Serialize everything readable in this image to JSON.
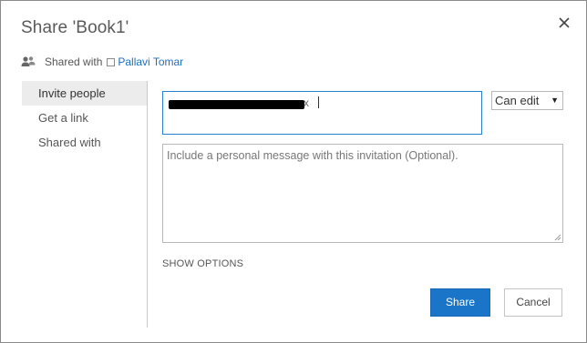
{
  "dialog": {
    "title": "Share 'Book1'"
  },
  "shared_with": {
    "label": "Shared with",
    "user": "Pallavi Tomar"
  },
  "nav": {
    "items": [
      {
        "label": "Invite people"
      },
      {
        "label": "Get a link"
      },
      {
        "label": "Shared with"
      }
    ]
  },
  "invite": {
    "chip_remove": "x"
  },
  "permission": {
    "selected": "Can edit"
  },
  "message": {
    "placeholder": "Include a personal message with this invitation (Optional)."
  },
  "options": {
    "label": "SHOW OPTIONS"
  },
  "buttons": {
    "share": "Share",
    "cancel": "Cancel"
  },
  "colors": {
    "accent": "#1a75c9",
    "link": "#1e6fbf",
    "focus_border": "#2a7fd4"
  }
}
